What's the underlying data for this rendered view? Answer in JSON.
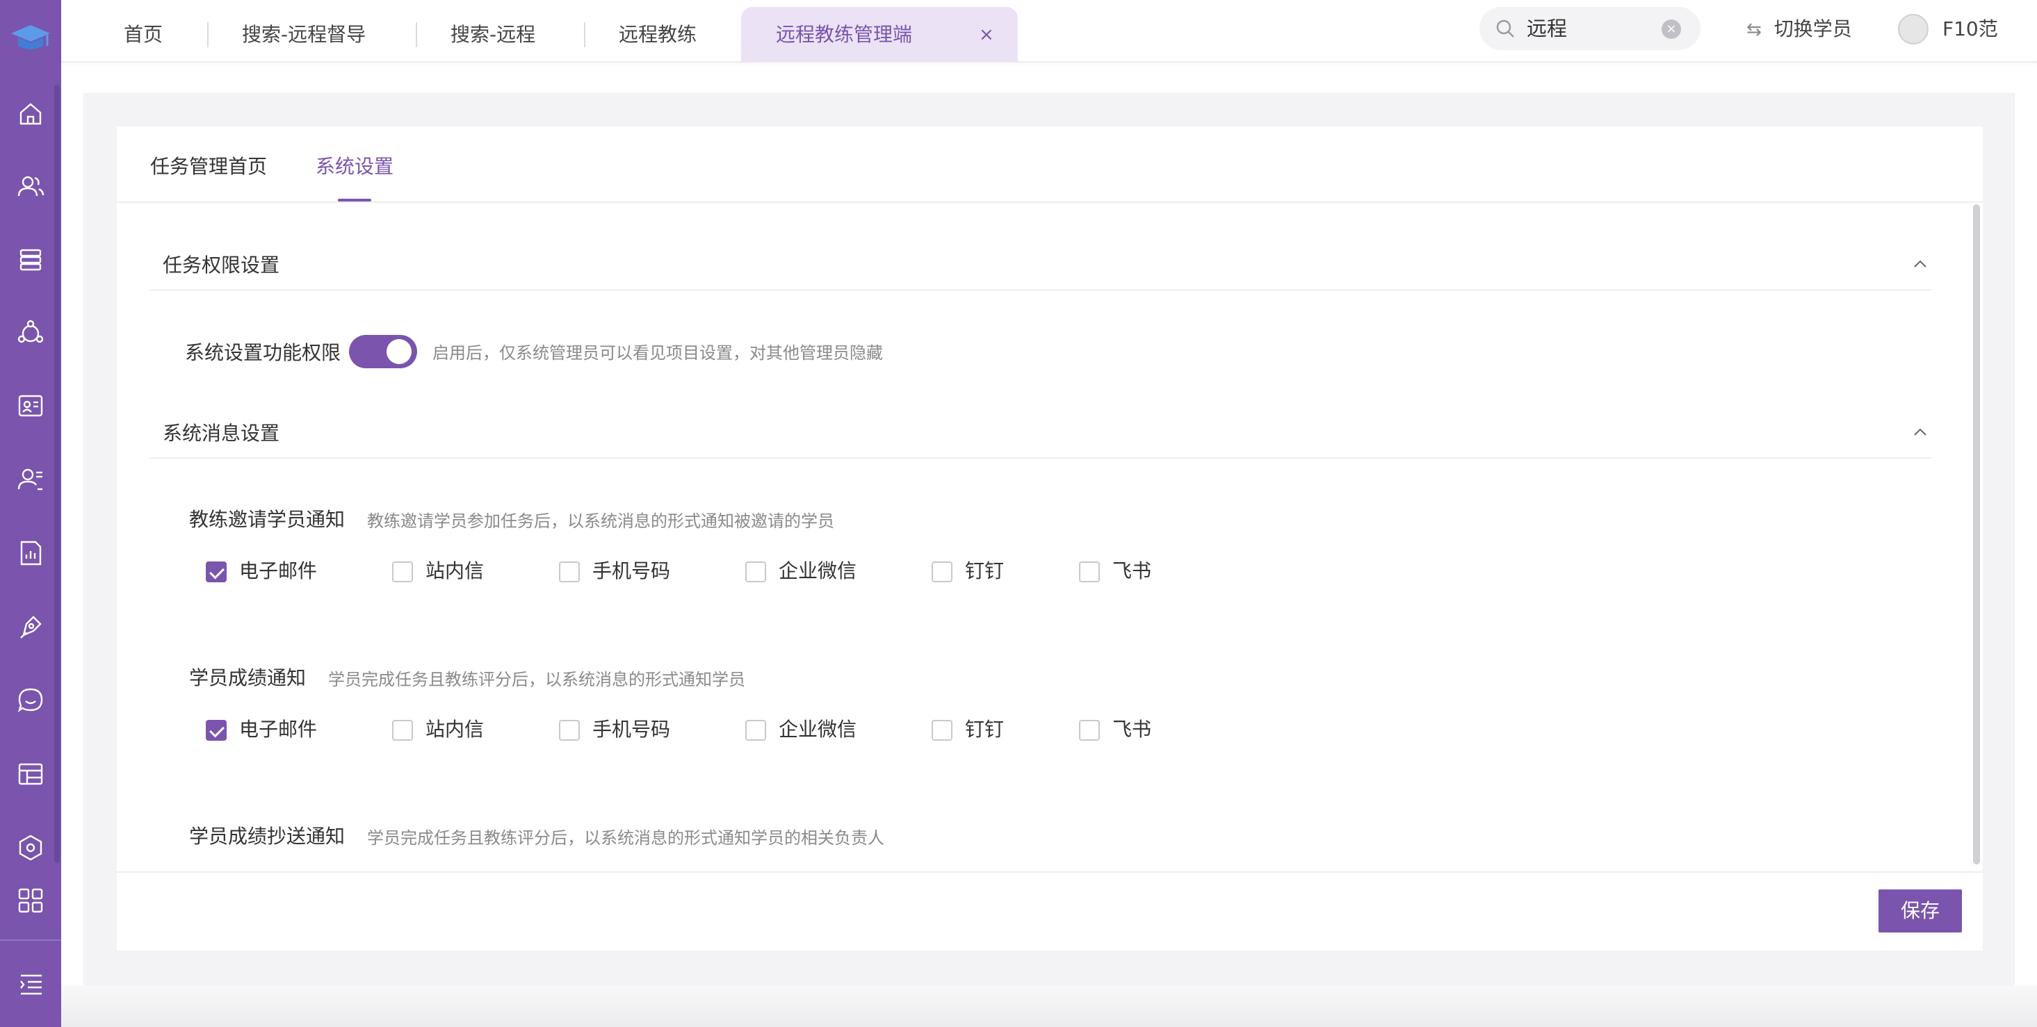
{
  "top_tabs": [
    "首页",
    "搜索-远程督导",
    "搜索-远程",
    "远程教练"
  ],
  "active_tab": {
    "label": "远程教练管理端",
    "close": "×"
  },
  "search": {
    "value": "远程",
    "clear": "×"
  },
  "switch_student": {
    "arrows": "⇆",
    "label": "切换学员"
  },
  "user": {
    "name": "F10范"
  },
  "sub_tabs": [
    "任务管理首页",
    "系统设置"
  ],
  "sections": {
    "permission": {
      "title": "任务权限设置",
      "toggle_label": "系统设置功能权限",
      "toggle_on": true,
      "hint": "启用后，仅系统管理员可以看见项目设置，对其他管理员隐藏"
    },
    "message": {
      "title": "系统消息设置",
      "notices": [
        {
          "title": "教练邀请学员通知",
          "hint": "教练邀请学员参加任务后，以系统消息的形式通知被邀请的学员"
        },
        {
          "title": "学员成绩通知",
          "hint": "学员完成任务且教练评分后，以系统消息的形式通知学员"
        },
        {
          "title": "学员成绩抄送通知",
          "hint": "学员完成任务且教练评分后，以系统消息的形式通知学员的相关负责人"
        }
      ]
    }
  },
  "channels": [
    "电子邮件",
    "站内信",
    "手机号码",
    "企业微信",
    "钉钉",
    "飞书"
  ],
  "checked": {
    "notice1": [
      "电子邮件"
    ],
    "notice2": [
      "电子邮件"
    ]
  },
  "save_label": "保存",
  "colors": {
    "accent": "#7a54ad",
    "active_tab_bg": "#ebe3f5",
    "page_bg": "#f3f3f5"
  },
  "sidebar_icons": [
    "home-icon",
    "users-icon",
    "database-icon",
    "network-icon",
    "contact-card-icon",
    "user-list-icon",
    "report-icon",
    "pen-icon",
    "chat-icon",
    "table-icon",
    "settings-hexagon-icon",
    "apps-grid-icon",
    "menu-expand-icon"
  ]
}
